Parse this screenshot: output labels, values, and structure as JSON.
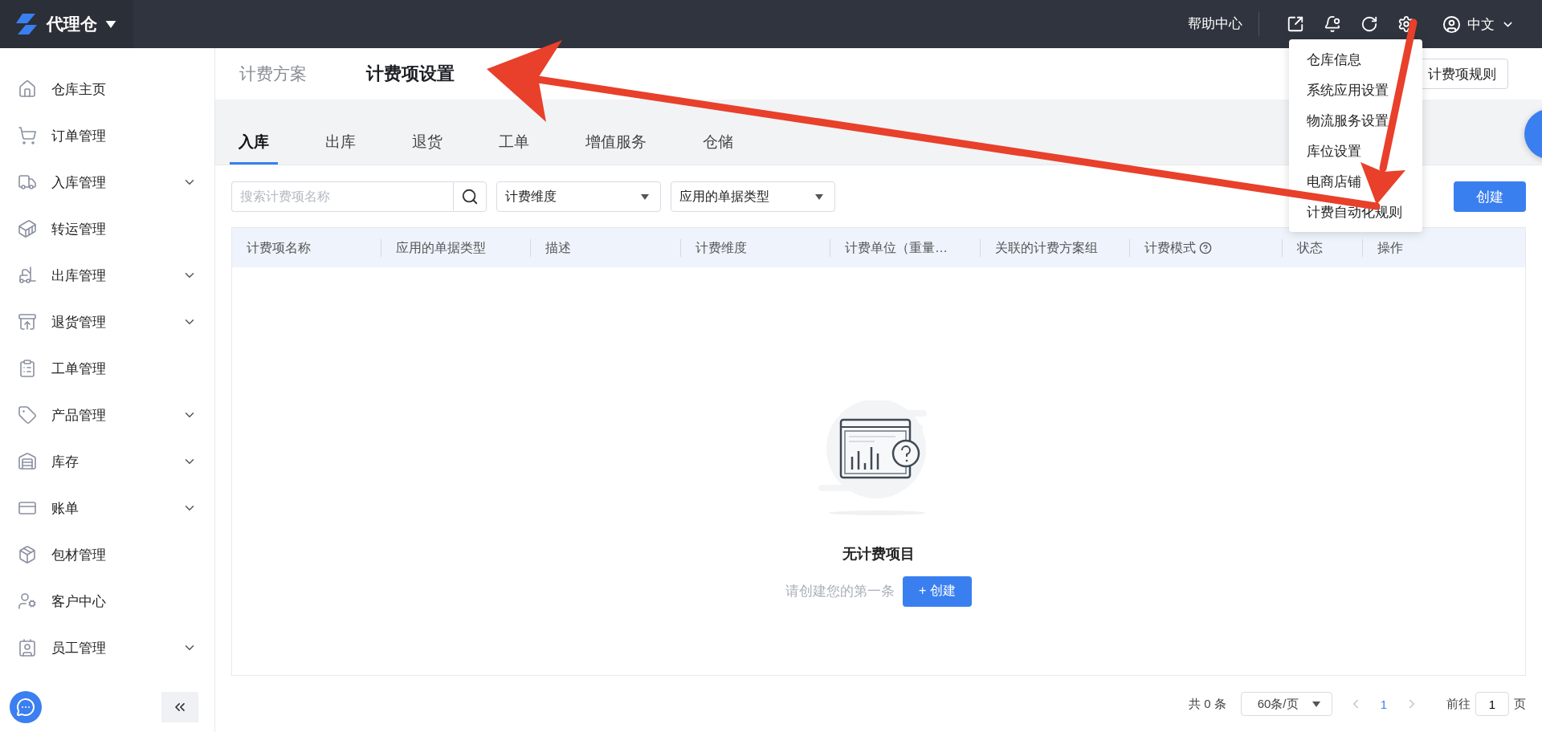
{
  "app": {
    "title": "代理仓"
  },
  "topbar": {
    "help": "帮助中心",
    "language": "中文"
  },
  "settings_menu": {
    "items": [
      "仓库信息",
      "系统应用设置",
      "物流服务设置",
      "库位设置",
      "电商店铺",
      "计费自动化规则"
    ]
  },
  "sidebar": {
    "items": [
      {
        "label": "仓库主页",
        "expandable": false
      },
      {
        "label": "订单管理",
        "expandable": false
      },
      {
        "label": "入库管理",
        "expandable": true
      },
      {
        "label": "转运管理",
        "expandable": false
      },
      {
        "label": "出库管理",
        "expandable": true
      },
      {
        "label": "退货管理",
        "expandable": true
      },
      {
        "label": "工单管理",
        "expandable": false
      },
      {
        "label": "产品管理",
        "expandable": true
      },
      {
        "label": "库存",
        "expandable": true
      },
      {
        "label": "账单",
        "expandable": true
      },
      {
        "label": "包材管理",
        "expandable": false
      },
      {
        "label": "客户中心",
        "expandable": false
      },
      {
        "label": "员工管理",
        "expandable": true
      }
    ]
  },
  "page_tabs": [
    {
      "label": "计费方案",
      "selected": false
    },
    {
      "label": "计费项设置",
      "selected": true
    }
  ],
  "header_button": "计费项规则",
  "sub_tabs": [
    {
      "label": "入库",
      "selected": true
    },
    {
      "label": "出库",
      "selected": false
    },
    {
      "label": "退货",
      "selected": false
    },
    {
      "label": "工单",
      "selected": false
    },
    {
      "label": "增值服务",
      "selected": false
    },
    {
      "label": "仓储",
      "selected": false
    }
  ],
  "filters": {
    "search": {
      "placeholder": "搜索计费项名称"
    },
    "dimension": {
      "placeholder": "计费维度"
    },
    "doc_type": {
      "placeholder": "应用的单据类型"
    }
  },
  "create_button": "创建",
  "table": {
    "columns": [
      {
        "label": "计费项名称",
        "help": false
      },
      {
        "label": "应用的单据类型",
        "help": false
      },
      {
        "label": "描述",
        "help": false
      },
      {
        "label": "计费维度",
        "help": false
      },
      {
        "label": "计费单位（重量…",
        "help": false
      },
      {
        "label": "关联的计费方案组",
        "help": false
      },
      {
        "label": "计费模式",
        "help": true
      },
      {
        "label": "状态",
        "help": false
      },
      {
        "label": "操作",
        "help": false
      }
    ]
  },
  "empty": {
    "title": "无计费项目",
    "hint": "请创建您的第一条",
    "button": "+ 创建"
  },
  "pagination": {
    "total": "共 0 条",
    "page_size": "60条/页",
    "pages": [
      {
        "label": "1",
        "selected": true
      }
    ],
    "goto_label": "前往",
    "goto_value": "1",
    "page_suffix": "页"
  }
}
